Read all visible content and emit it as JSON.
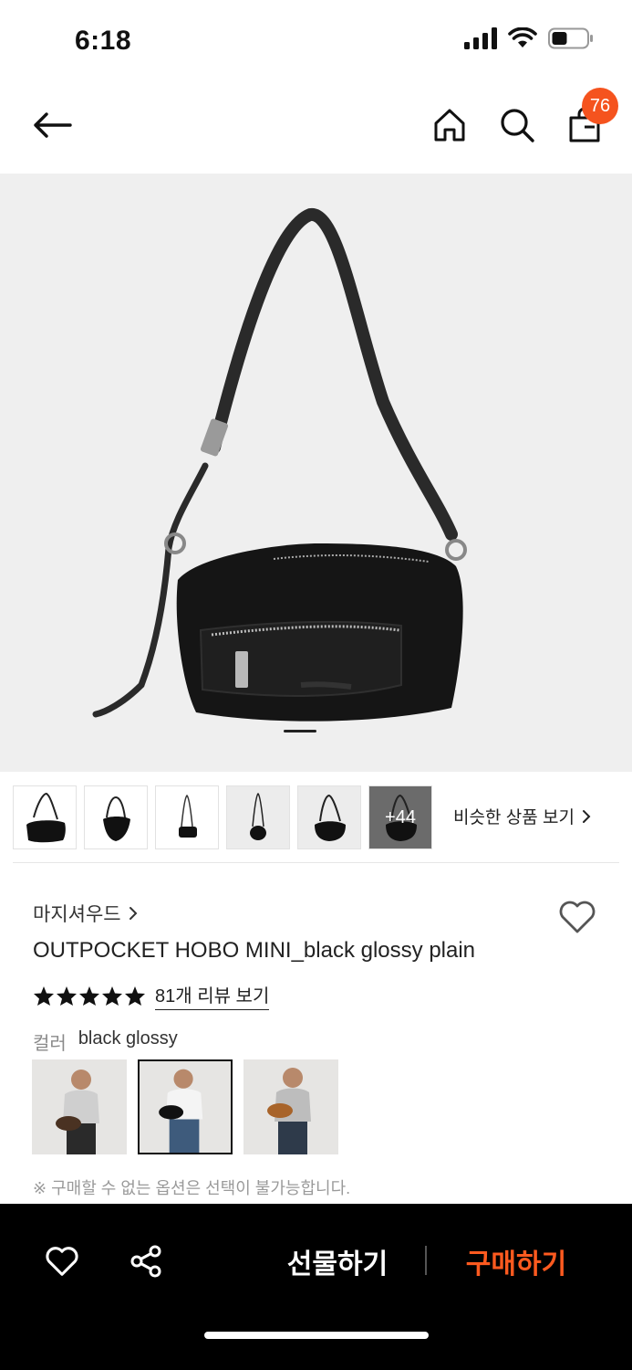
{
  "status_bar": {
    "time": "6:18"
  },
  "header": {
    "cart_count": "76",
    "icons": {
      "back": "arrow-left-icon",
      "home": "home-icon",
      "search": "search-icon",
      "cart": "shopping-bag-icon"
    }
  },
  "gallery": {
    "more_count": "+44",
    "similar_label": "비슷한 상품 보기"
  },
  "product": {
    "brand": "마지셔우드",
    "name": "OUTPOCKET HOBO MINI_black glossy plain",
    "rating_stars": 5,
    "review_link": "81개 리뷰 보기",
    "color_label": "컬러",
    "color_value": "black glossy",
    "option_note": "※ 구매할 수 없는 옵션은 선택이 불가능합니다."
  },
  "bottom_bar": {
    "gift_label": "선물하기",
    "buy_label": "구매하기"
  },
  "colors": {
    "accent": "#ff5a1f",
    "badge": "#f5531e"
  }
}
